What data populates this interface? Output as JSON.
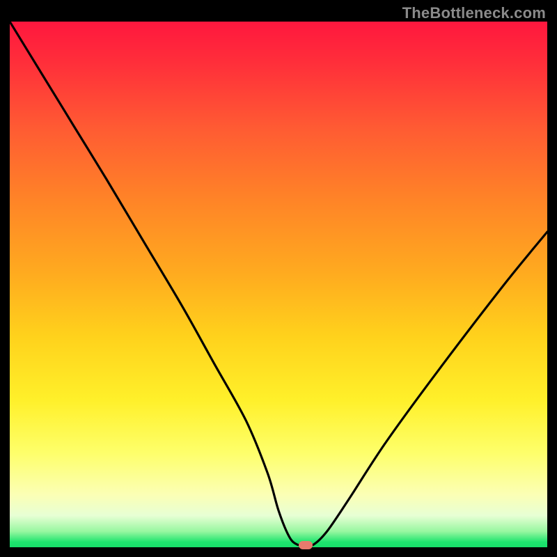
{
  "watermark": "TheBottleneck.com",
  "chart_data": {
    "type": "line",
    "title": "",
    "xlabel": "",
    "ylabel": "",
    "xlim": [
      0,
      100
    ],
    "ylim": [
      0,
      100
    ],
    "series": [
      {
        "name": "bottleneck-curve",
        "x": [
          0,
          6,
          12,
          18,
          25,
          32,
          38,
          44,
          48,
          50,
          52,
          53.5,
          55,
          56.5,
          59,
          63,
          70,
          80,
          92,
          100
        ],
        "y": [
          100,
          90,
          80,
          70,
          58,
          46,
          35,
          24,
          14,
          7,
          2,
          0.5,
          0.5,
          0.5,
          3,
          9,
          20,
          34,
          50,
          60
        ]
      }
    ],
    "flat_min": {
      "x_start": 50.5,
      "x_end": 56.5,
      "y": 0.5
    },
    "marker": {
      "x": 55.0,
      "y": 0.0,
      "color": "#e77a6d"
    },
    "gradient_stops": [
      {
        "pos": 0,
        "color": "#ff173e"
      },
      {
        "pos": 34,
        "color": "#ff8427"
      },
      {
        "pos": 60,
        "color": "#ffd21c"
      },
      {
        "pos": 90,
        "color": "#fbffb5"
      },
      {
        "pos": 100,
        "color": "#18df6a"
      }
    ]
  }
}
